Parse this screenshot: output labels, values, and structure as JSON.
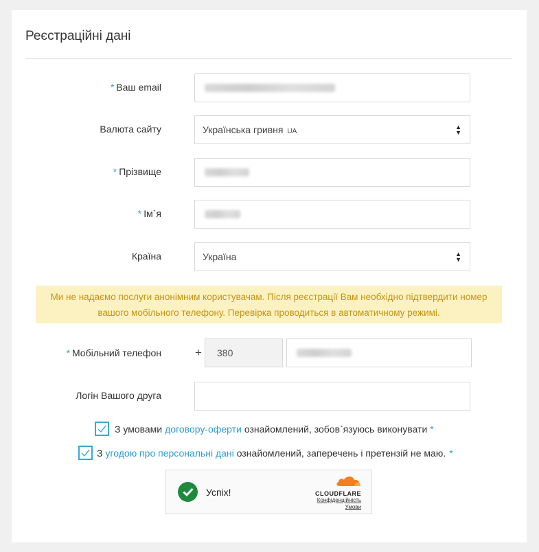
{
  "form": {
    "title": "Реєстраційні дані",
    "required_mark": "*",
    "email_label": "Ваш email",
    "currency_label": "Валюта сайту",
    "currency_value": "Українська гривня",
    "currency_code": "UA",
    "surname_label": "Прізвище",
    "name_label": "Ім`я",
    "country_label": "Країна",
    "country_value": "Україна",
    "alert": "Ми не надаємо послуги анонімним користувачам. Після реєстрації Вам необхідно підтвердити номер вашого мобільного телефону. Перевірка проводиться в автоматичному режимі.",
    "phone_label": "Мобільний телефон",
    "phone_plus": "+",
    "phone_code": "380",
    "friend_login_label": "Логін Вашого друга",
    "agree1_prefix": "З умовами",
    "agree1_link": "договору-оферти",
    "agree1_suffix": "ознайомлений, зобов`язуюсь виконувати",
    "agree2_prefix": "З",
    "agree2_link": "угодою про персональні дані",
    "agree2_suffix": "ознайомлений, заперечень і претензій не маю."
  },
  "captcha": {
    "status": "Успіх!",
    "brand": "CLOUDFLARE",
    "privacy_link": "Конфіденційність",
    "terms_link": "Умови"
  },
  "colors": {
    "accent": "#29a3d9",
    "alert_bg": "#fcf2c1",
    "alert_text": "#c6930d",
    "success": "#1e8a3e",
    "cloudflare_orange": "#f38020"
  }
}
